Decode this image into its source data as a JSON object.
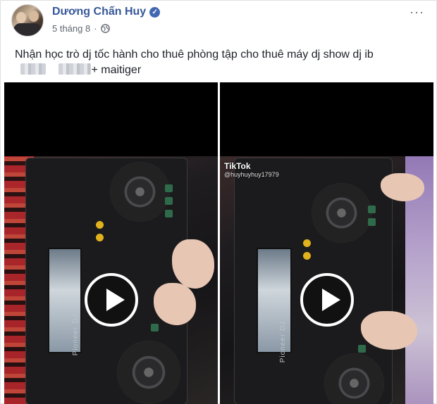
{
  "post": {
    "author": "Dương Chấn Huy",
    "verified_mark": "✓",
    "date": "5 tháng 8",
    "separator": "·",
    "more_glyph": "···",
    "text_line1": "Nhận học trò dj tốc hành cho thuê phòng tập cho thuê máy dj show dj ib",
    "text_line2_tail": "+ maitiger"
  },
  "videos": [
    {
      "label": "",
      "brand_text": "Pioneer DJ"
    },
    {
      "label": "TikTok",
      "handle": "@huyhuyhuy17979",
      "brand_text": "Pioneer DJ"
    }
  ],
  "colors": {
    "name": "#365899",
    "verified": "#4267b2",
    "meta": "#606770"
  },
  "icons": {
    "globe": "globe-icon",
    "more": "more-options-icon",
    "play": "play-icon"
  }
}
